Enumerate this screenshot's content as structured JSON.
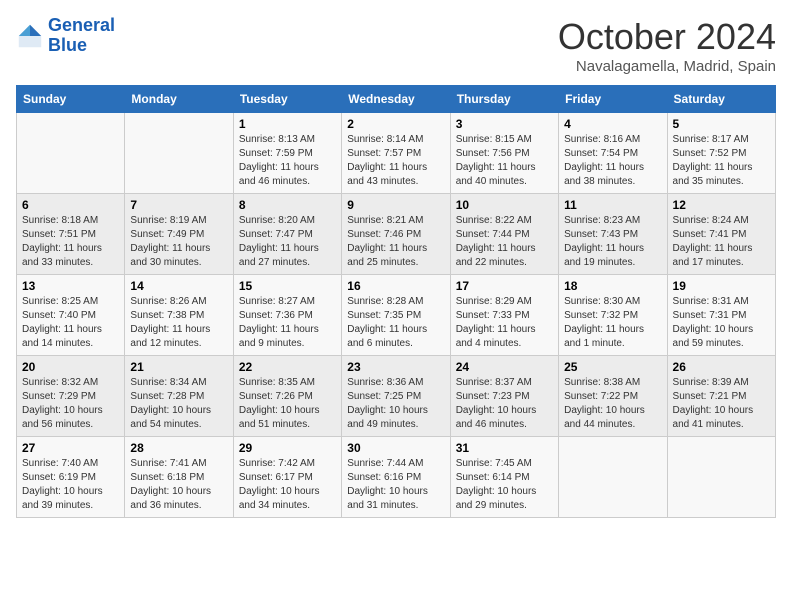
{
  "header": {
    "logo_line1": "General",
    "logo_line2": "Blue",
    "month_title": "October 2024",
    "location": "Navalagamella, Madrid, Spain"
  },
  "days_of_week": [
    "Sunday",
    "Monday",
    "Tuesday",
    "Wednesday",
    "Thursday",
    "Friday",
    "Saturday"
  ],
  "weeks": [
    [
      {
        "num": "",
        "info": ""
      },
      {
        "num": "",
        "info": ""
      },
      {
        "num": "1",
        "info": "Sunrise: 8:13 AM\nSunset: 7:59 PM\nDaylight: 11 hours and 46 minutes."
      },
      {
        "num": "2",
        "info": "Sunrise: 8:14 AM\nSunset: 7:57 PM\nDaylight: 11 hours and 43 minutes."
      },
      {
        "num": "3",
        "info": "Sunrise: 8:15 AM\nSunset: 7:56 PM\nDaylight: 11 hours and 40 minutes."
      },
      {
        "num": "4",
        "info": "Sunrise: 8:16 AM\nSunset: 7:54 PM\nDaylight: 11 hours and 38 minutes."
      },
      {
        "num": "5",
        "info": "Sunrise: 8:17 AM\nSunset: 7:52 PM\nDaylight: 11 hours and 35 minutes."
      }
    ],
    [
      {
        "num": "6",
        "info": "Sunrise: 8:18 AM\nSunset: 7:51 PM\nDaylight: 11 hours and 33 minutes."
      },
      {
        "num": "7",
        "info": "Sunrise: 8:19 AM\nSunset: 7:49 PM\nDaylight: 11 hours and 30 minutes."
      },
      {
        "num": "8",
        "info": "Sunrise: 8:20 AM\nSunset: 7:47 PM\nDaylight: 11 hours and 27 minutes."
      },
      {
        "num": "9",
        "info": "Sunrise: 8:21 AM\nSunset: 7:46 PM\nDaylight: 11 hours and 25 minutes."
      },
      {
        "num": "10",
        "info": "Sunrise: 8:22 AM\nSunset: 7:44 PM\nDaylight: 11 hours and 22 minutes."
      },
      {
        "num": "11",
        "info": "Sunrise: 8:23 AM\nSunset: 7:43 PM\nDaylight: 11 hours and 19 minutes."
      },
      {
        "num": "12",
        "info": "Sunrise: 8:24 AM\nSunset: 7:41 PM\nDaylight: 11 hours and 17 minutes."
      }
    ],
    [
      {
        "num": "13",
        "info": "Sunrise: 8:25 AM\nSunset: 7:40 PM\nDaylight: 11 hours and 14 minutes."
      },
      {
        "num": "14",
        "info": "Sunrise: 8:26 AM\nSunset: 7:38 PM\nDaylight: 11 hours and 12 minutes."
      },
      {
        "num": "15",
        "info": "Sunrise: 8:27 AM\nSunset: 7:36 PM\nDaylight: 11 hours and 9 minutes."
      },
      {
        "num": "16",
        "info": "Sunrise: 8:28 AM\nSunset: 7:35 PM\nDaylight: 11 hours and 6 minutes."
      },
      {
        "num": "17",
        "info": "Sunrise: 8:29 AM\nSunset: 7:33 PM\nDaylight: 11 hours and 4 minutes."
      },
      {
        "num": "18",
        "info": "Sunrise: 8:30 AM\nSunset: 7:32 PM\nDaylight: 11 hours and 1 minute."
      },
      {
        "num": "19",
        "info": "Sunrise: 8:31 AM\nSunset: 7:31 PM\nDaylight: 10 hours and 59 minutes."
      }
    ],
    [
      {
        "num": "20",
        "info": "Sunrise: 8:32 AM\nSunset: 7:29 PM\nDaylight: 10 hours and 56 minutes."
      },
      {
        "num": "21",
        "info": "Sunrise: 8:34 AM\nSunset: 7:28 PM\nDaylight: 10 hours and 54 minutes."
      },
      {
        "num": "22",
        "info": "Sunrise: 8:35 AM\nSunset: 7:26 PM\nDaylight: 10 hours and 51 minutes."
      },
      {
        "num": "23",
        "info": "Sunrise: 8:36 AM\nSunset: 7:25 PM\nDaylight: 10 hours and 49 minutes."
      },
      {
        "num": "24",
        "info": "Sunrise: 8:37 AM\nSunset: 7:23 PM\nDaylight: 10 hours and 46 minutes."
      },
      {
        "num": "25",
        "info": "Sunrise: 8:38 AM\nSunset: 7:22 PM\nDaylight: 10 hours and 44 minutes."
      },
      {
        "num": "26",
        "info": "Sunrise: 8:39 AM\nSunset: 7:21 PM\nDaylight: 10 hours and 41 minutes."
      }
    ],
    [
      {
        "num": "27",
        "info": "Sunrise: 7:40 AM\nSunset: 6:19 PM\nDaylight: 10 hours and 39 minutes."
      },
      {
        "num": "28",
        "info": "Sunrise: 7:41 AM\nSunset: 6:18 PM\nDaylight: 10 hours and 36 minutes."
      },
      {
        "num": "29",
        "info": "Sunrise: 7:42 AM\nSunset: 6:17 PM\nDaylight: 10 hours and 34 minutes."
      },
      {
        "num": "30",
        "info": "Sunrise: 7:44 AM\nSunset: 6:16 PM\nDaylight: 10 hours and 31 minutes."
      },
      {
        "num": "31",
        "info": "Sunrise: 7:45 AM\nSunset: 6:14 PM\nDaylight: 10 hours and 29 minutes."
      },
      {
        "num": "",
        "info": ""
      },
      {
        "num": "",
        "info": ""
      }
    ]
  ]
}
